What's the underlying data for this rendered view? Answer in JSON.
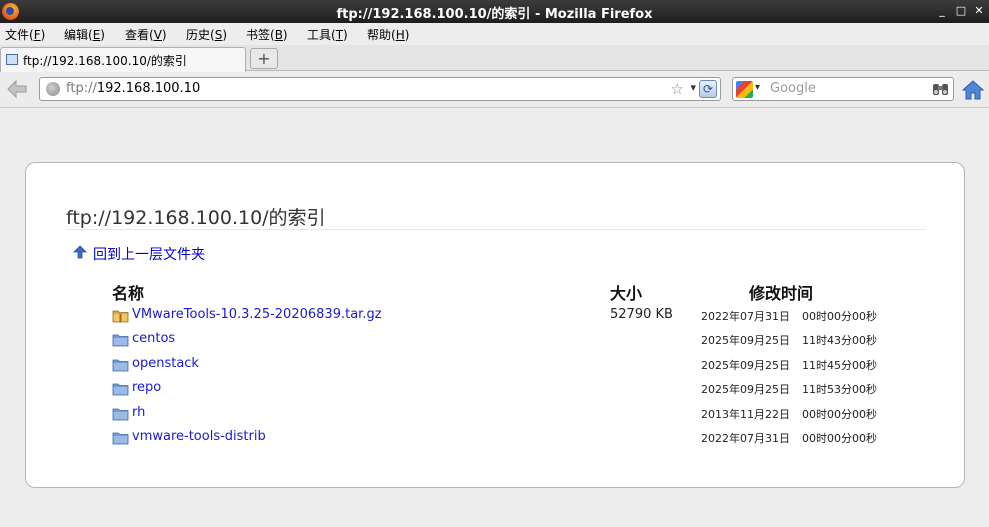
{
  "window": {
    "title": "ftp://192.168.100.10/的索引 - Mozilla Firefox"
  },
  "menu": [
    {
      "text": "文件(",
      "key": "F",
      "end": ")"
    },
    {
      "text": "编辑(",
      "key": "E",
      "end": ")"
    },
    {
      "text": "查看(",
      "key": "V",
      "end": ")"
    },
    {
      "text": "历史(",
      "key": "S",
      "end": ")"
    },
    {
      "text": "书签(",
      "key": "B",
      "end": ")"
    },
    {
      "text": "工具(",
      "key": "T",
      "end": ")"
    },
    {
      "text": "帮助(",
      "key": "H",
      "end": ")"
    }
  ],
  "tab": {
    "label": "ftp://192.168.100.10/的索引",
    "new_tab_symbol": "+"
  },
  "nav": {
    "url_scheme": "ftp://",
    "url_host": "192.168.100.10",
    "search_placeholder": "Google"
  },
  "listing": {
    "heading": "ftp://192.168.100.10/的索引",
    "up_link": "回到上一层文件夹",
    "columns": {
      "name": "名称",
      "size": "大小",
      "modified": "修改时间"
    },
    "rows": [
      {
        "name": "VMwareTools-10.3.25-20206839.tar.gz",
        "type": "archive",
        "size": "52790 KB",
        "date": "2022年07月31日",
        "time": "00时00分00秒"
      },
      {
        "name": "centos",
        "type": "folder",
        "size": "",
        "date": "2025年09月25日",
        "time": "11时43分00秒"
      },
      {
        "name": "openstack",
        "type": "folder",
        "size": "",
        "date": "2025年09月25日",
        "time": "11时45分00秒"
      },
      {
        "name": "repo",
        "type": "folder",
        "size": "",
        "date": "2025年09月25日",
        "time": "11时53分00秒"
      },
      {
        "name": "rh",
        "type": "folder",
        "size": "",
        "date": "2013年11月22日",
        "time": "00时00分00秒"
      },
      {
        "name": "vmware-tools-distrib",
        "type": "folder",
        "size": "",
        "date": "2022年07月31日",
        "time": "00时00分00秒"
      }
    ]
  }
}
